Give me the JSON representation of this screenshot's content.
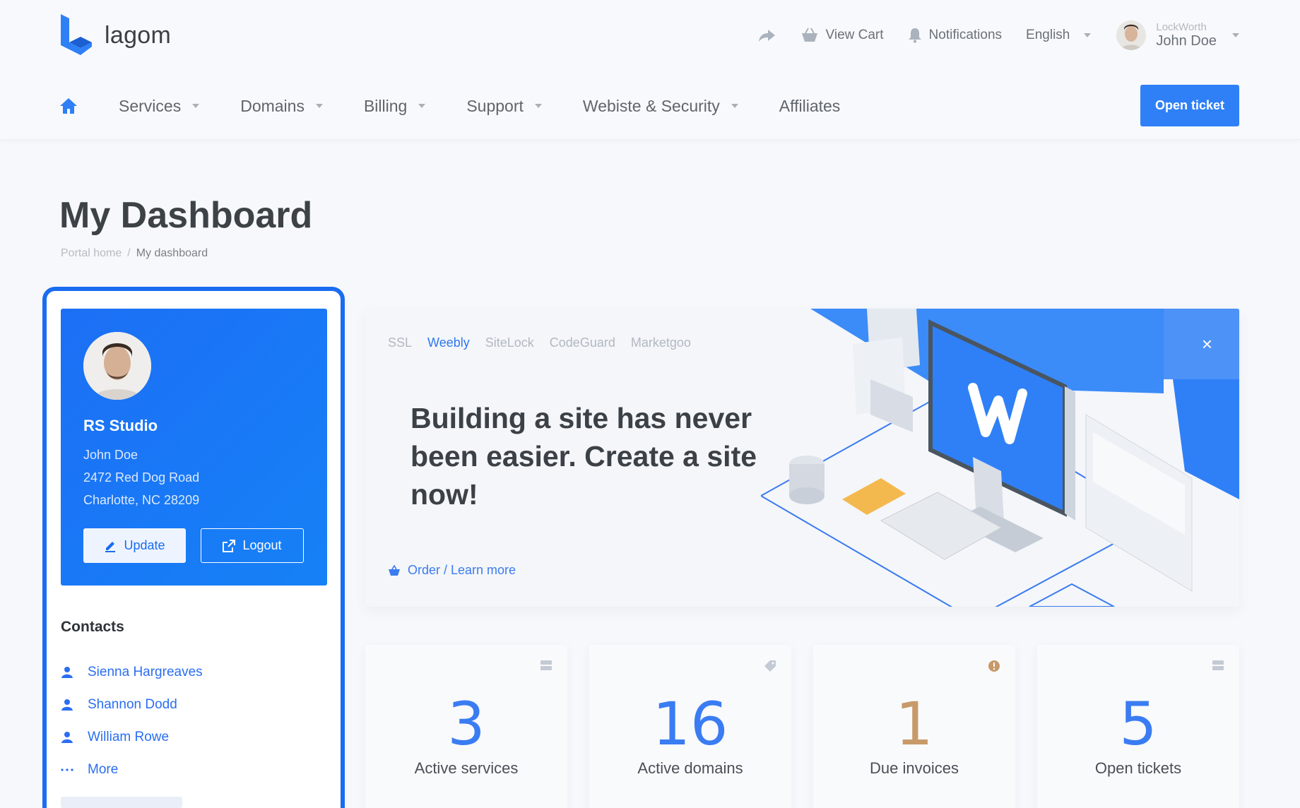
{
  "brand": {
    "name": "lagom",
    "color": "#2f80f7"
  },
  "topnav": {
    "view_cart": "View Cart",
    "notifications": "Notifications",
    "language": "English",
    "user_company": "LockWorth",
    "user_name": "John Doe"
  },
  "mainnav": {
    "items": [
      {
        "label": "Services"
      },
      {
        "label": "Domains"
      },
      {
        "label": "Billing"
      },
      {
        "label": "Support"
      },
      {
        "label": "Webiste & Security"
      },
      {
        "label": "Affiliates"
      }
    ],
    "open_ticket": "Open ticket"
  },
  "page": {
    "title": "My Dashboard",
    "breadcrumb": {
      "home": "Portal home",
      "separator": "/",
      "current": "My dashboard"
    }
  },
  "profile": {
    "company": "RS Studio",
    "name": "John Doe",
    "address1": "2472 Red Dog Road",
    "address2": "Charlotte, NC 28209",
    "update": "Update",
    "logout": "Logout"
  },
  "contacts": {
    "title": "Contacts",
    "items": [
      "Sienna Hargreaves",
      "Shannon Dodd",
      "William Rowe"
    ],
    "more": "More"
  },
  "promo": {
    "tabs": [
      "SSL",
      "Weebly",
      "SiteLock",
      "CodeGuard",
      "Marketgoo"
    ],
    "active_tab": "Weebly",
    "heading": "Building a site has never been easier. Create a site now!",
    "link": "Order / Learn more",
    "close": "×"
  },
  "stats": [
    {
      "value": "3",
      "label": "Active services",
      "color": "#3a7cf2",
      "icon": "server-icon"
    },
    {
      "value": "16",
      "label": "Active domains",
      "color": "#3a7cf2",
      "icon": "tag-icon"
    },
    {
      "value": "1",
      "label": "Due invoices",
      "color": "#c89a6a",
      "icon": "alert-icon"
    },
    {
      "value": "5",
      "label": "Open tickets",
      "color": "#3a7cf2",
      "icon": "ticket-icon"
    }
  ]
}
